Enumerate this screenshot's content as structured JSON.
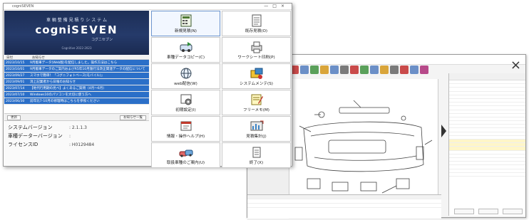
{
  "front_window": {
    "title": "cogniSEVEN",
    "banner": {
      "subtitle": "車 輌 整 備 見 積 り シ ス テ ム",
      "logo_left": "cogni",
      "logo_right": "SEVEN",
      "logo_kana": "コグニセブン",
      "copyright": "Cognitive 2022-2023"
    },
    "news": {
      "col_date": "日付",
      "col_notice": "お知らせ",
      "items": [
        {
          "date": "2023/10/15",
          "text": "9月版車データ(Web版)を配信しました。操作方法はこちら"
        },
        {
          "date": "2023/10/01",
          "text": "9月版車データのご案内およびR5年10月施行法改正関連データの配信について"
        },
        {
          "date": "2023/09/27",
          "text": "スマホで簡単！「コグニフォトベース(モバイル)」"
        },
        {
          "date": "2023/09/01",
          "text": "消上記業者から日報のお知らせ"
        },
        {
          "date": "2023/07/14",
          "text": "【地代行用期の見べ】よくあるご質問（4月〜6月）"
        },
        {
          "date": "2023/07/10",
          "text": "Windows10のパソコンを大切に使う方へ"
        },
        {
          "date": "2023/06/30",
          "text": "前年比7-10月の修理時はこちらを参照ください"
        }
      ]
    },
    "buttons": {
      "update": "更新",
      "news_list": "お知らせ一覧"
    },
    "info": {
      "system_version_label": "システムバージョン",
      "system_version_value": ": 2.1.1.3",
      "vehicle_version_label": "車種データーバージョン",
      "vehicle_version_value": ":",
      "license_label": "ライセンスID",
      "license_value": ": H0129484"
    },
    "tiles": [
      {
        "label": "新規見積(N)",
        "icon": "new-estimate-icon"
      },
      {
        "label": "既存見積(O)",
        "icon": "existing-estimate-icon"
      },
      {
        "label": "車種データコピー(C)",
        "icon": "vehicle-data-copy-icon"
      },
      {
        "label": "ワークシート印刷(P)",
        "icon": "worksheet-print-icon"
      },
      {
        "label": "web配信(W)",
        "icon": "web-delivery-icon"
      },
      {
        "label": "システムメンテ(S)",
        "icon": "system-maintenance-icon"
      },
      {
        "label": "初期設定(I)",
        "icon": "initial-settings-icon"
      },
      {
        "label": "フリーメモ(M)",
        "icon": "free-memo-icon"
      },
      {
        "label": "情報・操作ヘルプ(H)",
        "icon": "help-icon"
      },
      {
        "label": "見積集計(J)",
        "icon": "estimate-summary-icon"
      },
      {
        "label": "取扱車種のご案内(U)",
        "icon": "vehicle-guide-icon"
      },
      {
        "label": "終了(X)",
        "icon": "exit-icon"
      }
    ]
  },
  "back_window": {
    "close_glyph": "×"
  },
  "colors": {
    "banner_navy": "#1d2f57",
    "highlight_blue": "#2b6fc8"
  }
}
